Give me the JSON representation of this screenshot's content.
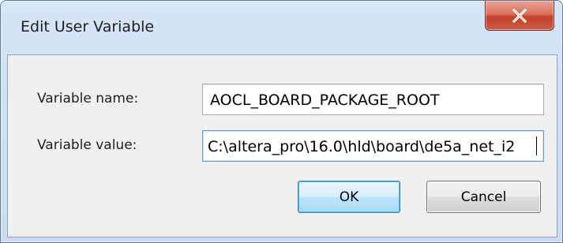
{
  "window": {
    "title": "Edit User Variable"
  },
  "fields": {
    "name_label": "Variable name:",
    "name_value": "AOCL_BOARD_PACKAGE_ROOT",
    "value_label": "Variable value:",
    "value_value": "C:\\altera_pro\\16.0\\hld\\board\\de5a_net_i2"
  },
  "buttons": {
    "ok_label": "OK",
    "cancel_label": "Cancel"
  },
  "icons": {
    "close": "close-icon"
  },
  "colors": {
    "close_button": "#c2422d",
    "default_button_border": "#3c7fb1",
    "frame": "#cfe1f3"
  }
}
